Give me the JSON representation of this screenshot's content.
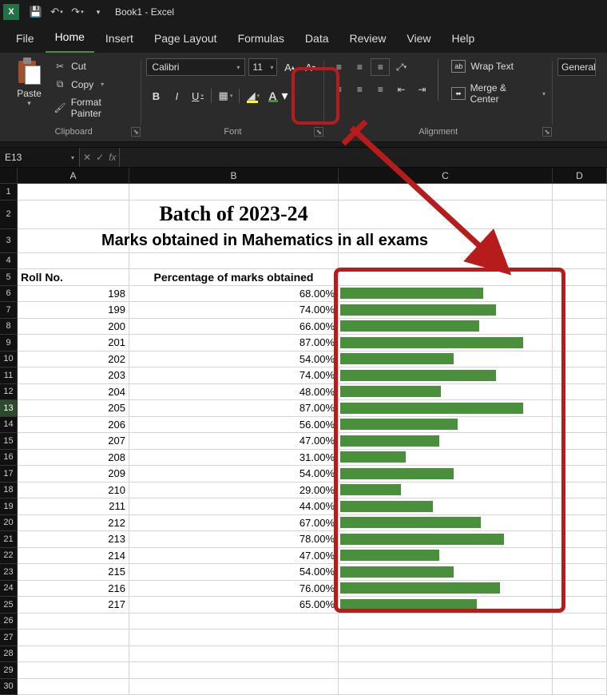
{
  "title": "Book1 - Excel",
  "menus": [
    "File",
    "Home",
    "Insert",
    "Page Layout",
    "Formulas",
    "Data",
    "Review",
    "View",
    "Help"
  ],
  "active_menu": "Home",
  "clipboard": {
    "cut": "Cut",
    "copy": "Copy",
    "fmtpaint": "Format Painter",
    "paste": "Paste",
    "label": "Clipboard"
  },
  "font": {
    "name": "Calibri",
    "size": "11",
    "label": "Font"
  },
  "alignment": {
    "wrap": "Wrap Text",
    "merge": "Merge & Center",
    "label": "Alignment"
  },
  "number": {
    "format": "General"
  },
  "namebox": "E13",
  "formula": "",
  "columns": [
    "A",
    "B",
    "C",
    "D"
  ],
  "sheet": {
    "title": "Batch of 2023-24",
    "subtitle": "Marks obtained in Mahematics in all exams",
    "col_a_header": "Roll No.",
    "col_b_header": "Percentage of marks obtained"
  },
  "chart_data": {
    "type": "bar",
    "title": "Percentage of marks obtained",
    "xlabel": "",
    "ylabel": "",
    "ylim": [
      0,
      100
    ],
    "categories": [
      198,
      199,
      200,
      201,
      202,
      203,
      204,
      205,
      206,
      207,
      208,
      209,
      210,
      211,
      212,
      213,
      214,
      215,
      216,
      217
    ],
    "values": [
      68.0,
      74.0,
      66.0,
      87.0,
      54.0,
      74.0,
      48.0,
      87.0,
      56.0,
      47.0,
      31.0,
      54.0,
      29.0,
      44.0,
      67.0,
      78.0,
      47.0,
      54.0,
      76.0,
      65.0
    ],
    "value_suffix": "%"
  }
}
